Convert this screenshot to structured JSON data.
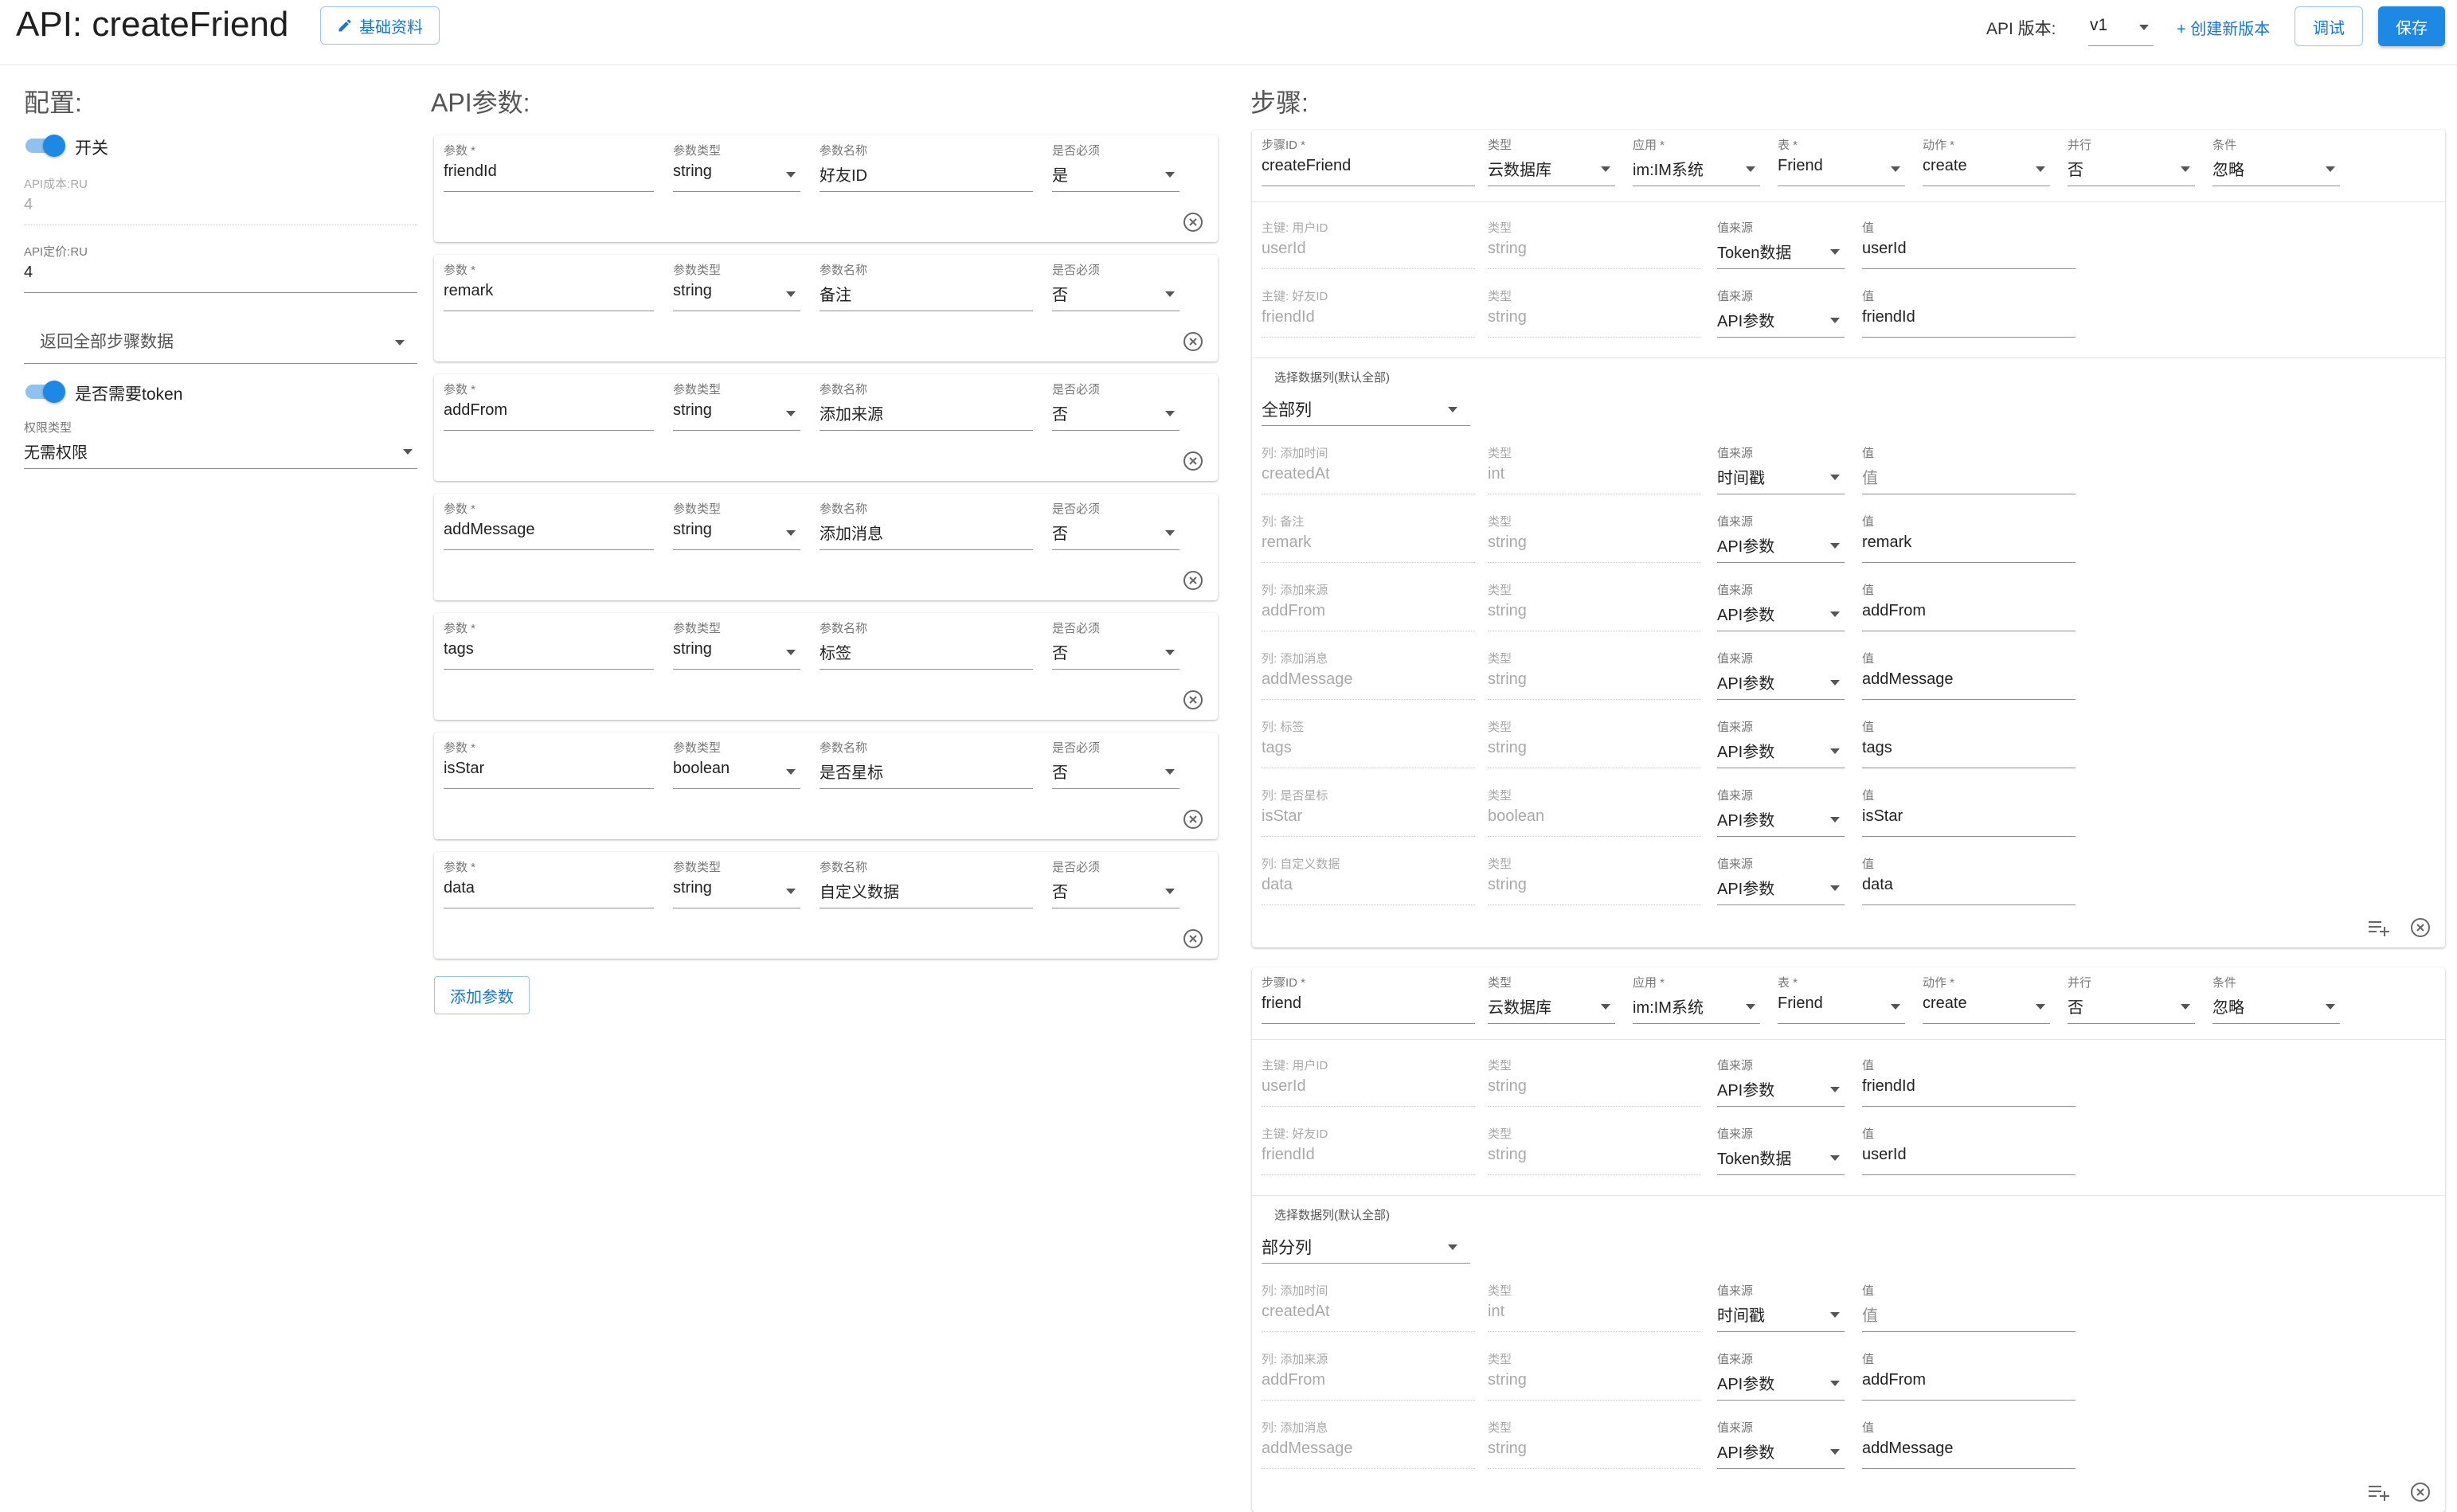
{
  "header": {
    "title": "API: createFriend",
    "basic_info_label": "基础资料",
    "version_label": "API 版本:",
    "version_value": "v1",
    "create_version_label": "+ 创建新版本",
    "debug_label": "调试",
    "save_label": "保存"
  },
  "config": {
    "title": "配置:",
    "switch_label": "开关",
    "switch_on": true,
    "cost_label": "API成本:RU",
    "cost_value": "4",
    "price_label": "API定价:RU",
    "price_value": "4",
    "return_select": "返回全部步骤数据",
    "token_label": "是否需要token",
    "token_on": true,
    "permission_label": "权限类型",
    "permission_value": "无需权限"
  },
  "params": {
    "title": "API参数:",
    "labels": {
      "param": "参数 *",
      "type": "参数类型",
      "name": "参数名称",
      "required": "是否必须"
    },
    "items": [
      {
        "param": "friendId",
        "type": "string",
        "name": "好友ID",
        "required": "是"
      },
      {
        "param": "remark",
        "type": "string",
        "name": "备注",
        "required": "否"
      },
      {
        "param": "addFrom",
        "type": "string",
        "name": "添加来源",
        "required": "否"
      },
      {
        "param": "addMessage",
        "type": "string",
        "name": "添加消息",
        "required": "否"
      },
      {
        "param": "tags",
        "type": "string",
        "name": "标签",
        "required": "否"
      },
      {
        "param": "isStar",
        "type": "boolean",
        "name": "是否星标",
        "required": "否"
      },
      {
        "param": "data",
        "type": "string",
        "name": "自定义数据",
        "required": "否"
      }
    ],
    "add_button": "添加参数"
  },
  "steps": {
    "title": "步骤:",
    "labels": {
      "step_id": "步骤ID *",
      "type": "类型",
      "app": "应用 *",
      "table": "表 *",
      "action": "动作 *",
      "parallel": "并行",
      "condition": "条件",
      "value_source": "值来源",
      "value": "值",
      "col_type": "类型",
      "select_columns": "选择数据列(默认全部)"
    },
    "items": [
      {
        "step_id": "createFriend",
        "type": "云数据库",
        "app": "im:IM系统",
        "table": "Friend",
        "action": "create",
        "parallel": "否",
        "condition": "忽略",
        "keys": [
          {
            "label": "主键: 用户ID",
            "col": "userId",
            "type": "string",
            "source": "Token数据",
            "value": "userId"
          },
          {
            "label": "主键: 好友ID",
            "col": "friendId",
            "type": "string",
            "source": "API参数",
            "value": "friendId"
          }
        ],
        "columns_select": "全部列",
        "columns": [
          {
            "label": "列: 添加时间",
            "col": "createdAt",
            "type": "int",
            "source": "时间戳",
            "value": "值",
            "placeholder": true
          },
          {
            "label": "列: 备注",
            "col": "remark",
            "type": "string",
            "source": "API参数",
            "value": "remark"
          },
          {
            "label": "列: 添加来源",
            "col": "addFrom",
            "type": "string",
            "source": "API参数",
            "value": "addFrom"
          },
          {
            "label": "列: 添加消息",
            "col": "addMessage",
            "type": "string",
            "source": "API参数",
            "value": "addMessage"
          },
          {
            "label": "列: 标签",
            "col": "tags",
            "type": "string",
            "source": "API参数",
            "value": "tags"
          },
          {
            "label": "列: 是否星标",
            "col": "isStar",
            "type": "boolean",
            "source": "API参数",
            "value": "isStar"
          },
          {
            "label": "列: 自定义数据",
            "col": "data",
            "type": "string",
            "source": "API参数",
            "value": "data"
          }
        ]
      },
      {
        "step_id": "friend",
        "type": "云数据库",
        "app": "im:IM系统",
        "table": "Friend",
        "action": "create",
        "parallel": "否",
        "condition": "忽略",
        "keys": [
          {
            "label": "主键: 用户ID",
            "col": "userId",
            "type": "string",
            "source": "API参数",
            "value": "friendId"
          },
          {
            "label": "主键: 好友ID",
            "col": "friendId",
            "type": "string",
            "source": "Token数据",
            "value": "userId"
          }
        ],
        "columns_select": "部分列",
        "columns": [
          {
            "label": "列: 添加时间",
            "col": "createdAt",
            "type": "int",
            "source": "时间戳",
            "value": "值",
            "placeholder": true
          },
          {
            "label": "列: 添加来源",
            "col": "addFrom",
            "type": "string",
            "source": "API参数",
            "value": "addFrom"
          },
          {
            "label": "列: 添加消息",
            "col": "addMessage",
            "type": "string",
            "source": "API参数",
            "value": "addMessage"
          }
        ]
      }
    ]
  },
  "colors": {
    "primary": "#1e88e5",
    "toggle_track": "#90c2f0",
    "muted": "#a9a9a9"
  },
  "icons": {
    "edit": "pencil-icon",
    "remove": "close-circle-icon",
    "add_column": "playlist-add-icon"
  }
}
